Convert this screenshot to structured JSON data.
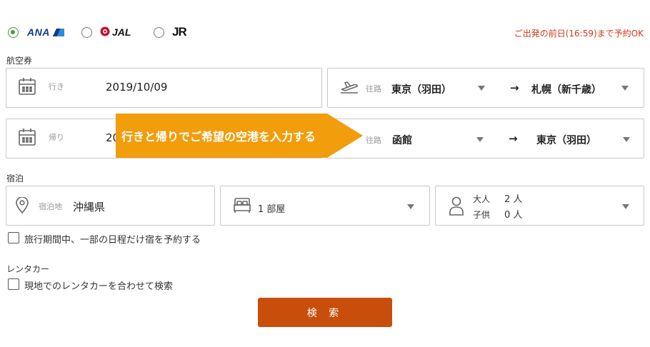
{
  "airlines": [
    {
      "label": "ANA",
      "selected": true
    },
    {
      "label": "JAL",
      "selected": false
    },
    {
      "label": "JR",
      "selected": false
    }
  ],
  "notice": "ご出発の前日(16:59)まで予約OK",
  "flight": {
    "section_label": "航空券",
    "outbound": {
      "date_label": "行き",
      "date": "2019/10/09",
      "route_label": "往路",
      "from": "東京（羽田）",
      "arrow": "→",
      "to": "札幌（新千歳）"
    },
    "return": {
      "date_label": "帰り",
      "date": "20",
      "route_label": "往路",
      "from": "函館",
      "arrow": "→",
      "to": "東京（羽田）"
    },
    "callout": "行きと帰りでご希望の空港を入力する"
  },
  "hotel": {
    "section_label": "宿泊",
    "destination_label": "宿泊地",
    "destination": "沖縄県",
    "rooms": "1 部屋",
    "adults_label": "大人",
    "adults": "2 人",
    "children_label": "子供",
    "children": "0 人",
    "partial_stay_label": "旅行期間中、一部の日程だけ宿を予約する"
  },
  "rental_car": {
    "section_label": "レンタカー",
    "checkbox_label": "現地でのレンタカーを合わせて検索"
  },
  "search_button": "検 索",
  "colors": {
    "accent_orange": "#c94e0b",
    "callout_orange": "#f19d0c",
    "notice_red": "#d23b1b",
    "radio_green": "#4a9a3a",
    "ana_blue": "#143c8c",
    "jal_red": "#c8102e"
  },
  "icons": [
    "calendar-icon",
    "airplane-icon",
    "location-pin-icon",
    "bed-icon",
    "person-icon",
    "caret-down-icon"
  ]
}
